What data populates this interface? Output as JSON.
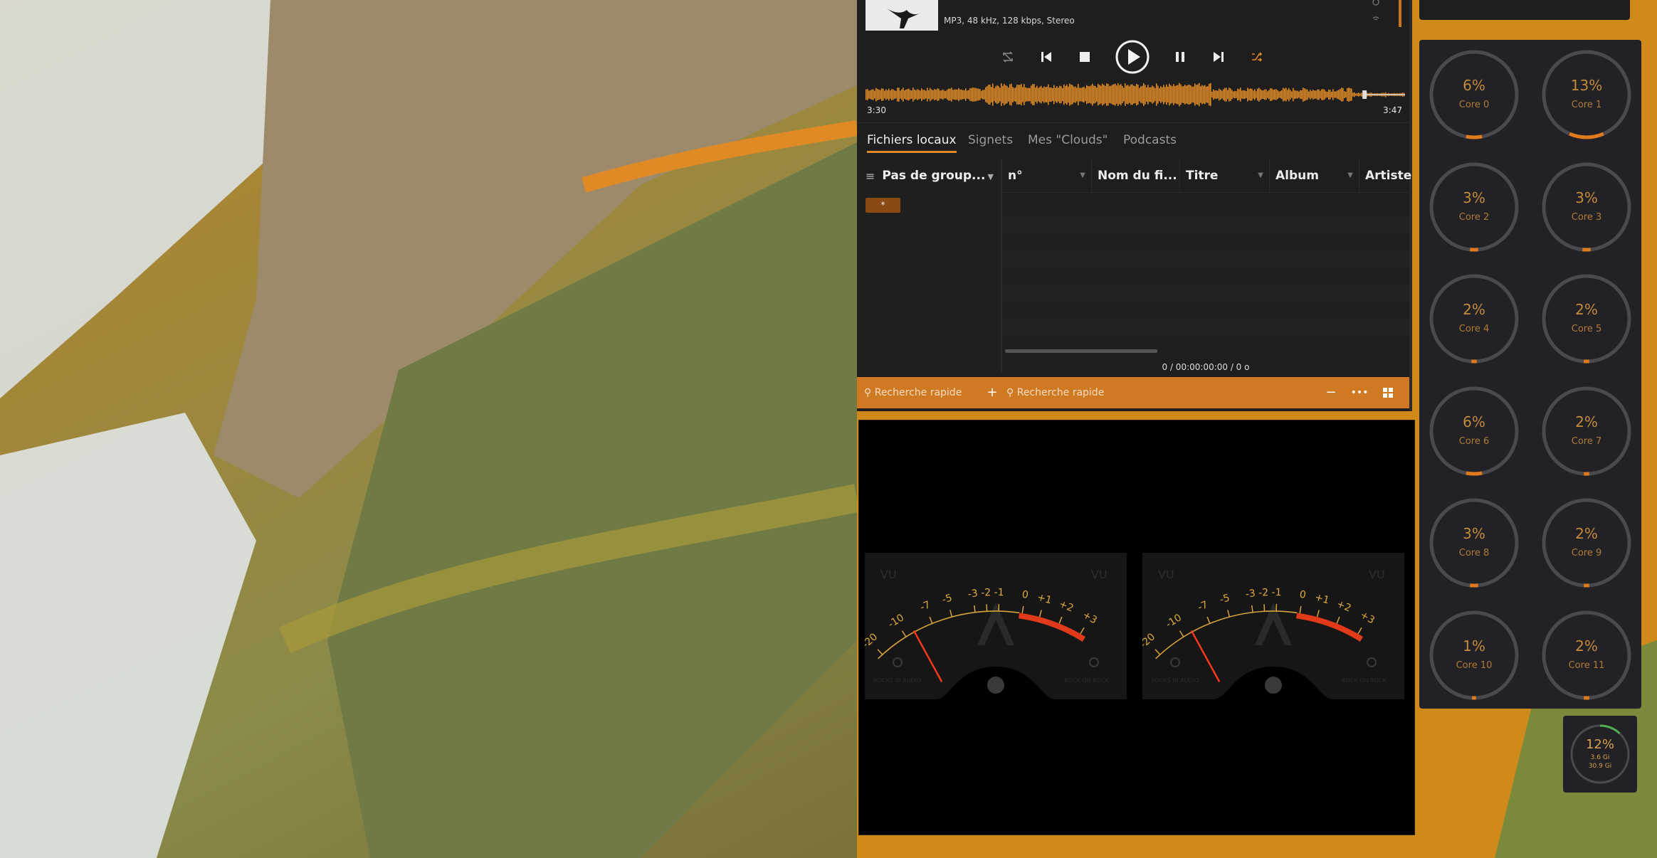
{
  "now_playing": {
    "format": "MP3, 48 kHz, 128 kbps, Stereo"
  },
  "transport": {
    "buttons": [
      "repeat",
      "previous",
      "stop",
      "play",
      "pause",
      "next",
      "shuffle"
    ]
  },
  "progress": {
    "elapsed": "3:30",
    "total": "3:47",
    "fraction": 0.925
  },
  "tabs": [
    {
      "label": "Fichiers locaux",
      "active": true
    },
    {
      "label": "Signets",
      "active": false
    },
    {
      "label": "Mes \"Clouds\"",
      "active": false
    },
    {
      "label": "Podcasts",
      "active": false
    }
  ],
  "library": {
    "group_label": "Pas de group...",
    "group_item": "*",
    "columns": [
      "n°",
      "Nom du fi...",
      "Titre",
      "Album",
      "Artiste"
    ],
    "status": "0 / 00:00:00:00 / 0 o"
  },
  "search": {
    "left_placeholder": "Recherche rapide",
    "right_placeholder": "Recherche rapide"
  },
  "vu_meters": {
    "label": "VU",
    "scale": [
      "-20",
      "-10",
      "-7",
      "-5",
      "-3",
      "-2",
      "-1",
      "0",
      "+1",
      "+2",
      "+3"
    ],
    "brand_left": "ROCKS IN AUDIO",
    "brand_right": "ROCK ON ROCK",
    "meters": [
      {
        "name": "left",
        "needle_db": -9
      },
      {
        "name": "right",
        "needle_db": -9
      }
    ]
  },
  "cpu": {
    "cores": [
      {
        "label": "Core 0",
        "percent": "6%",
        "value": 0.06
      },
      {
        "label": "Core 1",
        "percent": "13%",
        "value": 0.13
      },
      {
        "label": "Core 2",
        "percent": "3%",
        "value": 0.03
      },
      {
        "label": "Core 3",
        "percent": "3%",
        "value": 0.03
      },
      {
        "label": "Core 4",
        "percent": "2%",
        "value": 0.02
      },
      {
        "label": "Core 5",
        "percent": "2%",
        "value": 0.02
      },
      {
        "label": "Core 6",
        "percent": "6%",
        "value": 0.06
      },
      {
        "label": "Core 7",
        "percent": "2%",
        "value": 0.02
      },
      {
        "label": "Core 8",
        "percent": "3%",
        "value": 0.03
      },
      {
        "label": "Core 9",
        "percent": "2%",
        "value": 0.02
      },
      {
        "label": "Core 10",
        "percent": "1%",
        "value": 0.01
      },
      {
        "label": "Core 11",
        "percent": "2%",
        "value": 0.02
      }
    ]
  },
  "memory": {
    "percent": "12%",
    "value": 0.12,
    "used": "3.6 Gi",
    "total": "30.9 Gi"
  },
  "colors": {
    "accent": "#e08a26",
    "search_bar": "#cf7a22",
    "gauge_arc": "#e07a1c",
    "vu_red": "#e03a1a"
  }
}
